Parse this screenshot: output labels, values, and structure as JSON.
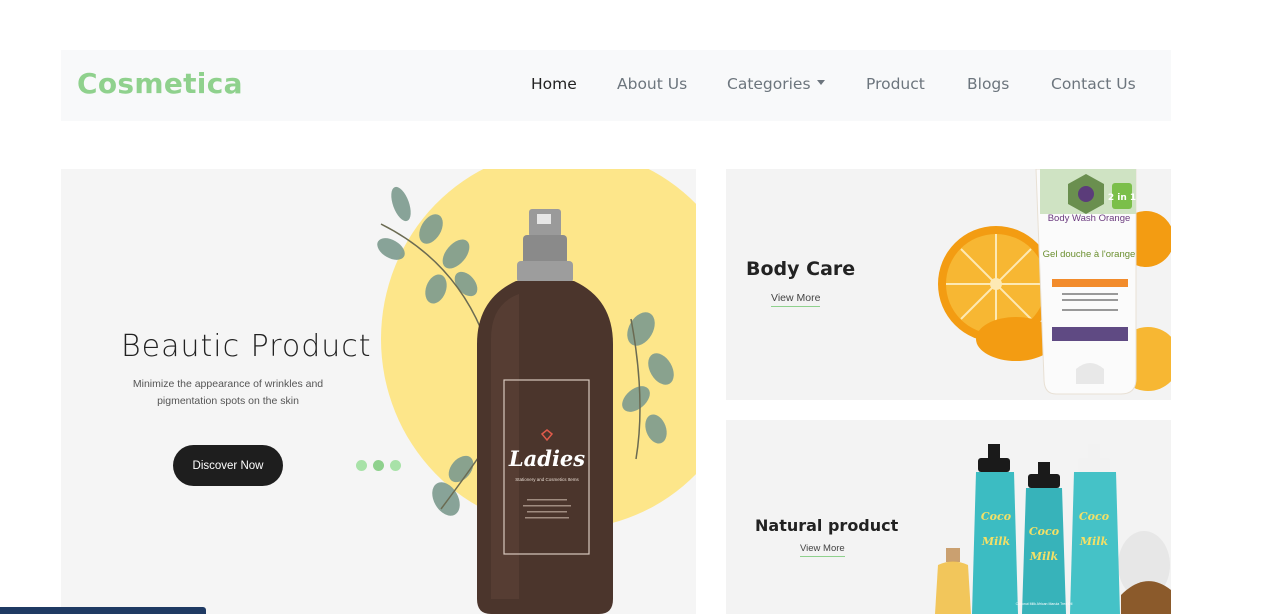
{
  "nav": {
    "brand": "Cosmetica",
    "links": [
      {
        "label": "Home",
        "active": true
      },
      {
        "label": "About Us"
      },
      {
        "label": "Categories",
        "dropdown": true
      },
      {
        "label": "Product"
      },
      {
        "label": "Blogs"
      },
      {
        "label": "Contact Us"
      }
    ]
  },
  "hero": {
    "title": "Beautic Product",
    "subtitle": "Minimize the appearance of wrinkles and pigmentation spots on the skin",
    "button": "Discover Now",
    "slide_count": 3,
    "active_slide": 2,
    "bottle_label": "Ladies",
    "bottle_sub": "Stationery and Cosmetics Items"
  },
  "promos": [
    {
      "title": "Body Care",
      "link": "View More",
      "tube_text_1": "Body Wash Orange",
      "tube_text_2": "Gel douche à l'orange",
      "tube_badge": "2 in 1"
    },
    {
      "title": "Natural product",
      "link": "View More",
      "bottle_text": "Coconut Milk African Marula Tree Oil"
    }
  ],
  "colors": {
    "accent": "#8fd18d",
    "dark": "#1e1e1e",
    "hero_circle": "#fde68a",
    "navbar_bg": "#f8f9fa"
  }
}
